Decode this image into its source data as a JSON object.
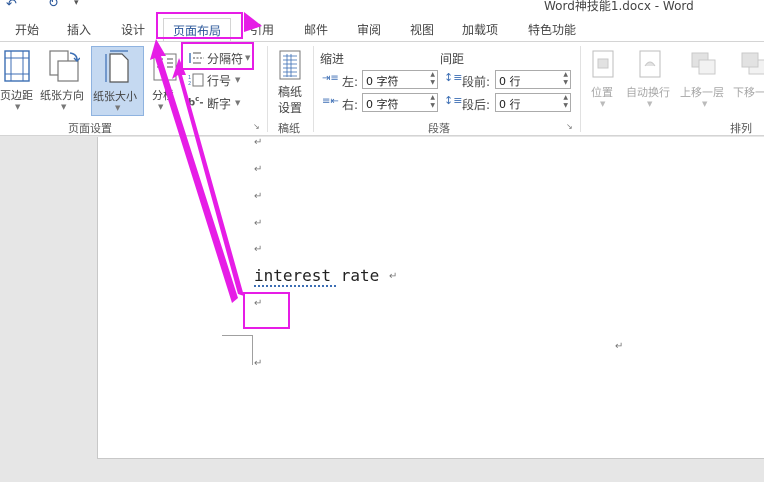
{
  "window": {
    "title": "Word神技能1.docx - Word"
  },
  "quick_access": {
    "undo_icon": "undo-icon",
    "redo_icon": "redo-icon",
    "customize": "▾"
  },
  "tabs": [
    {
      "label": "开始",
      "active": false
    },
    {
      "label": "插入",
      "active": false
    },
    {
      "label": "设计",
      "active": false
    },
    {
      "label": "页面布局",
      "active": true
    },
    {
      "label": "引用",
      "active": false
    },
    {
      "label": "邮件",
      "active": false
    },
    {
      "label": "审阅",
      "active": false
    },
    {
      "label": "视图",
      "active": false
    },
    {
      "label": "加载项",
      "active": false
    },
    {
      "label": "特色功能",
      "active": false
    }
  ],
  "page_setup": {
    "group_label": "页面设置",
    "margins": "页边距",
    "orientation": "纸张方向",
    "size": "纸张大小",
    "columns": "分栏",
    "breaks": "分隔符",
    "line_numbers": "行号",
    "hyphenation": "断字"
  },
  "manuscript": {
    "group_label": "稿纸",
    "settings_line1": "稿纸",
    "settings_line2": "设置"
  },
  "paragraph": {
    "group_label": "段落",
    "indent_header": "缩进",
    "spacing_header": "间距",
    "left_label": "左:",
    "left_value": "0 字符",
    "right_label": "右:",
    "right_value": "0 字符",
    "before_label": "段前:",
    "before_value": "0 行",
    "after_label": "段后:",
    "after_value": "0 行"
  },
  "arrange": {
    "group_label": "排列",
    "position": "位置",
    "wrap_text": "自动换行",
    "bring_forward": "上移一层",
    "send_backward": "下移一"
  },
  "document": {
    "text": "interest rate"
  },
  "colors": {
    "highlight": "#e61de6",
    "active_tab_text": "#2b579a",
    "size_button_bg": "#c5d9f1"
  }
}
